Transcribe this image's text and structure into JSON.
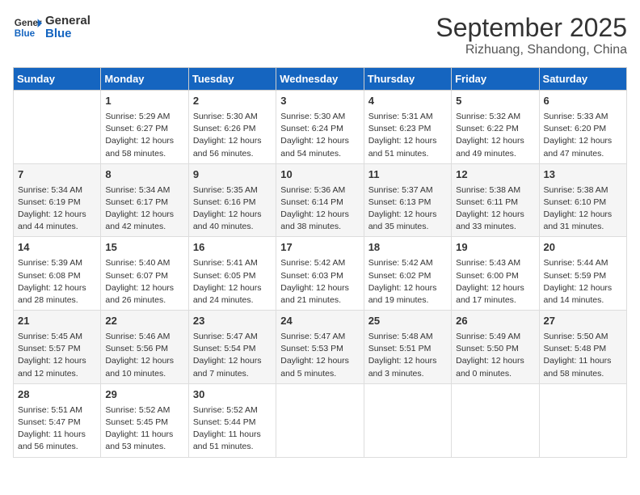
{
  "header": {
    "logo_general": "General",
    "logo_blue": "Blue",
    "month": "September 2025",
    "location": "Rizhuang, Shandong, China"
  },
  "days_of_week": [
    "Sunday",
    "Monday",
    "Tuesday",
    "Wednesday",
    "Thursday",
    "Friday",
    "Saturday"
  ],
  "weeks": [
    [
      {
        "day": "",
        "info": ""
      },
      {
        "day": "1",
        "info": "Sunrise: 5:29 AM\nSunset: 6:27 PM\nDaylight: 12 hours\nand 58 minutes."
      },
      {
        "day": "2",
        "info": "Sunrise: 5:30 AM\nSunset: 6:26 PM\nDaylight: 12 hours\nand 56 minutes."
      },
      {
        "day": "3",
        "info": "Sunrise: 5:30 AM\nSunset: 6:24 PM\nDaylight: 12 hours\nand 54 minutes."
      },
      {
        "day": "4",
        "info": "Sunrise: 5:31 AM\nSunset: 6:23 PM\nDaylight: 12 hours\nand 51 minutes."
      },
      {
        "day": "5",
        "info": "Sunrise: 5:32 AM\nSunset: 6:22 PM\nDaylight: 12 hours\nand 49 minutes."
      },
      {
        "day": "6",
        "info": "Sunrise: 5:33 AM\nSunset: 6:20 PM\nDaylight: 12 hours\nand 47 minutes."
      }
    ],
    [
      {
        "day": "7",
        "info": "Sunrise: 5:34 AM\nSunset: 6:19 PM\nDaylight: 12 hours\nand 44 minutes."
      },
      {
        "day": "8",
        "info": "Sunrise: 5:34 AM\nSunset: 6:17 PM\nDaylight: 12 hours\nand 42 minutes."
      },
      {
        "day": "9",
        "info": "Sunrise: 5:35 AM\nSunset: 6:16 PM\nDaylight: 12 hours\nand 40 minutes."
      },
      {
        "day": "10",
        "info": "Sunrise: 5:36 AM\nSunset: 6:14 PM\nDaylight: 12 hours\nand 38 minutes."
      },
      {
        "day": "11",
        "info": "Sunrise: 5:37 AM\nSunset: 6:13 PM\nDaylight: 12 hours\nand 35 minutes."
      },
      {
        "day": "12",
        "info": "Sunrise: 5:38 AM\nSunset: 6:11 PM\nDaylight: 12 hours\nand 33 minutes."
      },
      {
        "day": "13",
        "info": "Sunrise: 5:38 AM\nSunset: 6:10 PM\nDaylight: 12 hours\nand 31 minutes."
      }
    ],
    [
      {
        "day": "14",
        "info": "Sunrise: 5:39 AM\nSunset: 6:08 PM\nDaylight: 12 hours\nand 28 minutes."
      },
      {
        "day": "15",
        "info": "Sunrise: 5:40 AM\nSunset: 6:07 PM\nDaylight: 12 hours\nand 26 minutes."
      },
      {
        "day": "16",
        "info": "Sunrise: 5:41 AM\nSunset: 6:05 PM\nDaylight: 12 hours\nand 24 minutes."
      },
      {
        "day": "17",
        "info": "Sunrise: 5:42 AM\nSunset: 6:03 PM\nDaylight: 12 hours\nand 21 minutes."
      },
      {
        "day": "18",
        "info": "Sunrise: 5:42 AM\nSunset: 6:02 PM\nDaylight: 12 hours\nand 19 minutes."
      },
      {
        "day": "19",
        "info": "Sunrise: 5:43 AM\nSunset: 6:00 PM\nDaylight: 12 hours\nand 17 minutes."
      },
      {
        "day": "20",
        "info": "Sunrise: 5:44 AM\nSunset: 5:59 PM\nDaylight: 12 hours\nand 14 minutes."
      }
    ],
    [
      {
        "day": "21",
        "info": "Sunrise: 5:45 AM\nSunset: 5:57 PM\nDaylight: 12 hours\nand 12 minutes."
      },
      {
        "day": "22",
        "info": "Sunrise: 5:46 AM\nSunset: 5:56 PM\nDaylight: 12 hours\nand 10 minutes."
      },
      {
        "day": "23",
        "info": "Sunrise: 5:47 AM\nSunset: 5:54 PM\nDaylight: 12 hours\nand 7 minutes."
      },
      {
        "day": "24",
        "info": "Sunrise: 5:47 AM\nSunset: 5:53 PM\nDaylight: 12 hours\nand 5 minutes."
      },
      {
        "day": "25",
        "info": "Sunrise: 5:48 AM\nSunset: 5:51 PM\nDaylight: 12 hours\nand 3 minutes."
      },
      {
        "day": "26",
        "info": "Sunrise: 5:49 AM\nSunset: 5:50 PM\nDaylight: 12 hours\nand 0 minutes."
      },
      {
        "day": "27",
        "info": "Sunrise: 5:50 AM\nSunset: 5:48 PM\nDaylight: 11 hours\nand 58 minutes."
      }
    ],
    [
      {
        "day": "28",
        "info": "Sunrise: 5:51 AM\nSunset: 5:47 PM\nDaylight: 11 hours\nand 56 minutes."
      },
      {
        "day": "29",
        "info": "Sunrise: 5:52 AM\nSunset: 5:45 PM\nDaylight: 11 hours\nand 53 minutes."
      },
      {
        "day": "30",
        "info": "Sunrise: 5:52 AM\nSunset: 5:44 PM\nDaylight: 11 hours\nand 51 minutes."
      },
      {
        "day": "",
        "info": ""
      },
      {
        "day": "",
        "info": ""
      },
      {
        "day": "",
        "info": ""
      },
      {
        "day": "",
        "info": ""
      }
    ]
  ]
}
